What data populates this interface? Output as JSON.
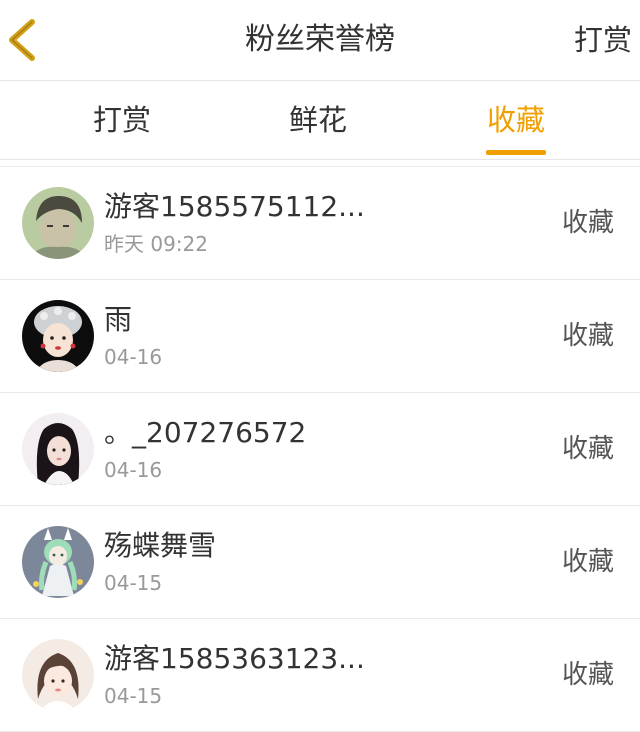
{
  "header": {
    "title": "粉丝荣誉榜",
    "action_label": "打赏",
    "back_icon": "chevron-left-icon",
    "back_icon_color": "#d4a017"
  },
  "tabs": [
    {
      "label": "打赏",
      "active": false
    },
    {
      "label": "鲜花",
      "active": false
    },
    {
      "label": "收藏",
      "active": true
    }
  ],
  "colors": {
    "accent": "#f0a000",
    "text": "#333333",
    "muted": "#999999",
    "divider": "#e9e9e9"
  },
  "list": [
    {
      "name": "游客1585575112...",
      "time": "昨天 09:22",
      "action": "收藏",
      "avatar": "avatar-boy-icon"
    },
    {
      "name": "雨",
      "time": "04-16",
      "action": "收藏",
      "avatar": "avatar-opera-girl-icon"
    },
    {
      "name": "。_207276572",
      "time": "04-16",
      "action": "收藏",
      "avatar": "avatar-girl-dark-hair-icon"
    },
    {
      "name": "殇蝶舞雪",
      "time": "04-15",
      "action": "收藏",
      "avatar": "avatar-anime-girl-icon"
    },
    {
      "name": "游客1585363123...",
      "time": "04-15",
      "action": "收藏",
      "avatar": "avatar-girl-light-icon"
    }
  ]
}
